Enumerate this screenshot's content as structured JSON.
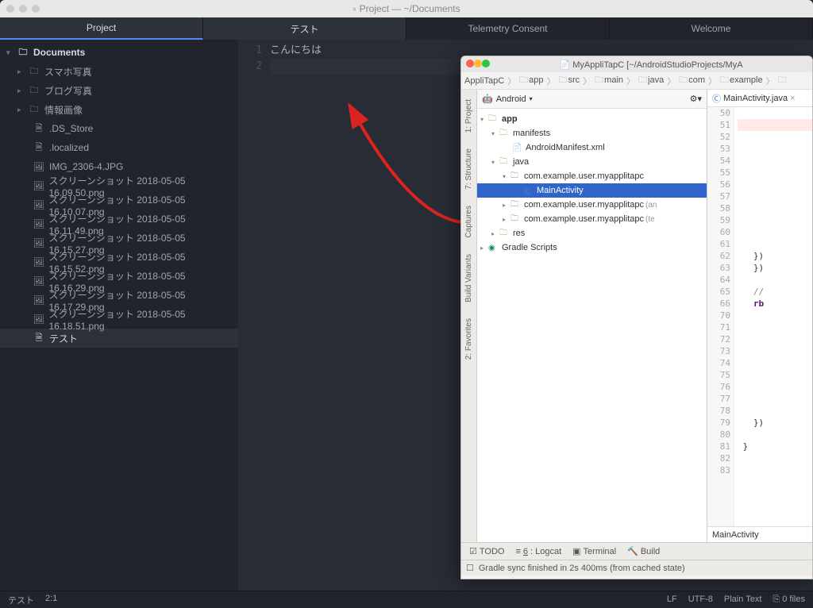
{
  "atom": {
    "window_title": "Project — ~/Documents",
    "tabs": {
      "project": "Project",
      "test": "テスト",
      "telemetry": "Telemetry Consent",
      "welcome": "Welcome"
    },
    "tree": {
      "root": "Documents",
      "folders": [
        "スマホ写真",
        "ブログ写真",
        "情報画像"
      ],
      "files": [
        ".DS_Store",
        ".localized",
        "IMG_2306-4.JPG",
        "スクリーンショット 2018-05-05 16.09.50.png",
        "スクリーンショット 2018-05-05 16.10.07.png",
        "スクリーンショット 2018-05-05 16.11.49.png",
        "スクリーンショット 2018-05-05 16.15.27.png",
        "スクリーンショット 2018-05-05 16.15.52.png",
        "スクリーンショット 2018-05-05 16.16.29.png",
        "スクリーンショット 2018-05-05 16.17.29.png",
        "スクリーンショット 2018-05-05 16.18.51.png",
        "テスト"
      ]
    },
    "editor": {
      "lines": [
        "こんにちは",
        ""
      ],
      "line_numbers": [
        "1",
        "2"
      ]
    },
    "status": {
      "filename": "テスト",
      "cursor": "2:1",
      "eol": "LF",
      "encoding": "UTF-8",
      "grammar": "Plain Text",
      "git": "0 files"
    }
  },
  "android_studio": {
    "window_title": "MyAppliTapC [~/AndroidStudioProjects/MyA",
    "breadcrumb": [
      "AppliTapC",
      "app",
      "src",
      "main",
      "java",
      "com",
      "example"
    ],
    "view_mode": "Android",
    "tree": {
      "app": "app",
      "manifests": "manifests",
      "manifest_file": "AndroidManifest.xml",
      "java": "java",
      "pkg1": "com.example.user.myapplitapc",
      "main_activity": "MainActivity",
      "pkg2": "com.example.user.myapplitapc",
      "pkg2_anno": "(an",
      "pkg3": "com.example.user.myapplitapc",
      "pkg3_anno": "(te",
      "res": "res",
      "gradle": "Gradle Scripts"
    },
    "left_tabs": [
      "1: Project",
      "7: Structure",
      "Captures",
      "Build Variants",
      "2: Favorites"
    ],
    "editor_tab": "MainActivity.java",
    "gutter_lines": [
      "50",
      "51",
      "52",
      "53",
      "54",
      "55",
      "56",
      "57",
      "58",
      "59",
      "60",
      "61",
      "62",
      "63",
      "64",
      "65",
      "66",
      "70",
      "71",
      "72",
      "73",
      "74",
      "75",
      "76",
      "77",
      "78",
      "79",
      "80",
      "81",
      "82",
      "83"
    ],
    "code_fragments": {
      "l62": "})",
      "l63": "})",
      "l65": "//",
      "l66": "rb",
      "l79": "})",
      "l81": "}"
    },
    "nav_footer": "MainActivity",
    "bottom_tabs": {
      "todo": "TODO",
      "logcat_prefix": "6",
      "logcat": ": Logcat",
      "terminal": "Terminal",
      "build": "Build"
    },
    "status_message": "Gradle sync finished in 2s 400ms (from cached state)"
  }
}
